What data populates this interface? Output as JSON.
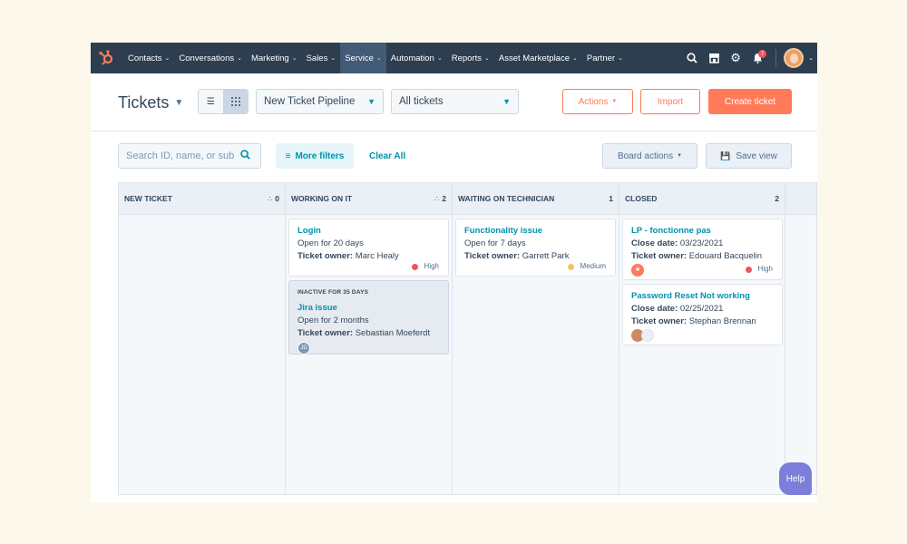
{
  "nav": {
    "items": [
      {
        "label": "Contacts"
      },
      {
        "label": "Conversations"
      },
      {
        "label": "Marketing"
      },
      {
        "label": "Sales"
      },
      {
        "label": "Service",
        "active": true
      },
      {
        "label": "Automation"
      },
      {
        "label": "Reports"
      },
      {
        "label": "Asset Marketplace"
      },
      {
        "label": "Partner"
      }
    ],
    "notification_count": "7"
  },
  "header": {
    "title": "Tickets",
    "pipeline": "New Ticket Pipeline",
    "view_filter": "All tickets",
    "actions_label": "Actions",
    "import_label": "Import",
    "create_label": "Create ticket"
  },
  "toolbar": {
    "search_placeholder": "Search ID, name, or sub",
    "more_filters": "More filters",
    "clear_all": "Clear All",
    "board_actions": "Board actions",
    "save_view": "Save view"
  },
  "columns": [
    {
      "name": "NEW TICKET",
      "count": "0",
      "cards": []
    },
    {
      "name": "WORKING ON IT",
      "count": "2",
      "cards": [
        {
          "title": "Login",
          "status": "Open for 20 days",
          "owner_label": "Ticket owner:",
          "owner": "Marc Healy",
          "priority": "High"
        },
        {
          "flag": "INACTIVE FOR 35 DAYS",
          "title": "Jira issue",
          "status": "Open for 2 months",
          "owner_label": "Ticket owner:",
          "owner": "Sebastian Moeferdt",
          "avatar": "JD"
        }
      ]
    },
    {
      "name": "WAITING ON TECHNICIAN",
      "count": "1",
      "cards": [
        {
          "title": "Functionality issue",
          "status": "Open for 7 days",
          "owner_label": "Ticket owner:",
          "owner": "Garrett Park",
          "priority": "Medium"
        }
      ]
    },
    {
      "name": "CLOSED",
      "count": "2",
      "cards": [
        {
          "title": "LP - fonctionne pas",
          "date_label": "Close date:",
          "date": "03/23/2021",
          "owner_label": "Ticket owner:",
          "owner": "Edouard Bacquelin",
          "priority": "High"
        },
        {
          "title": "Password Reset Not working",
          "date_label": "Close date:",
          "date": "02/25/2021",
          "owner_label": "Ticket owner:",
          "owner": "Stephan Brennan"
        }
      ]
    }
  ],
  "help_label": "Help",
  "colors": {
    "nav_bg": "#2d3e50",
    "accent": "#ff7a59",
    "link": "#0091ae",
    "high": "#f2545b",
    "medium": "#f5c26b"
  }
}
